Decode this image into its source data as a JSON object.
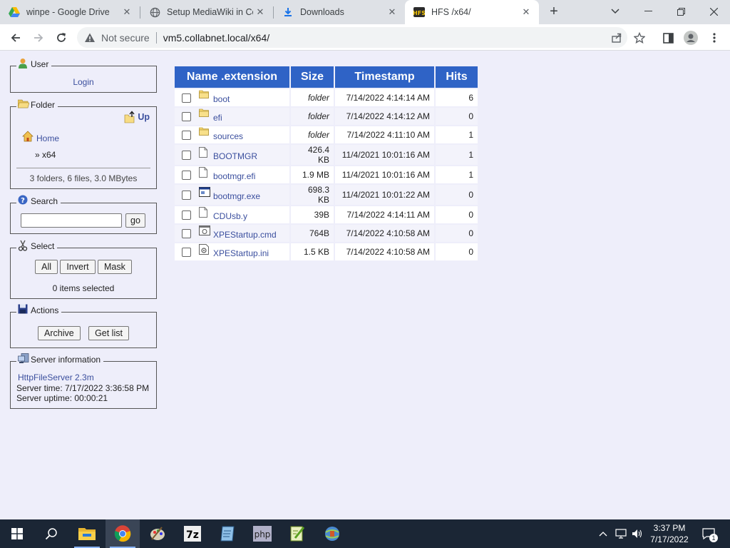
{
  "browser": {
    "tabs": [
      {
        "title": "winpe - Google Drive",
        "icon": "google-drive-icon"
      },
      {
        "title": "Setup MediaWiki in Co",
        "icon": "globe-icon"
      },
      {
        "title": "Downloads",
        "icon": "download-icon"
      },
      {
        "title": "HFS /x64/",
        "icon": "hfs-icon",
        "active": true
      }
    ],
    "security_label": "Not secure",
    "url": "vm5.collabnet.local/x64/"
  },
  "sidebar": {
    "user": {
      "legend": "User",
      "login": "Login"
    },
    "folder": {
      "legend": "Folder",
      "up": "Up",
      "home": "Home",
      "current": "» x64",
      "summary": "3 folders, 6 files, 3.0 MBytes"
    },
    "search": {
      "legend": "Search",
      "value": "",
      "go": "go"
    },
    "select": {
      "legend": "Select",
      "all": "All",
      "invert": "Invert",
      "mask": "Mask",
      "status": "0 items selected"
    },
    "actions": {
      "legend": "Actions",
      "archive": "Archive",
      "get_list": "Get list"
    },
    "server": {
      "legend": "Server information",
      "link": "HttpFileServer 2.3m",
      "time": "Server time: 7/17/2022 3:36:58 PM",
      "uptime": "Server uptime: 00:00:21"
    }
  },
  "table": {
    "headers": {
      "name": "Name .extension",
      "size": "Size",
      "timestamp": "Timestamp",
      "hits": "Hits"
    },
    "rows": [
      {
        "name": "boot",
        "type": "folder",
        "size": "folder",
        "timestamp": "7/14/2022 4:14:14 AM",
        "hits": "6"
      },
      {
        "name": "efi",
        "type": "folder",
        "size": "folder",
        "timestamp": "7/14/2022 4:14:12 AM",
        "hits": "0"
      },
      {
        "name": "sources",
        "type": "folder",
        "size": "folder",
        "timestamp": "7/14/2022 4:11:10 AM",
        "hits": "1"
      },
      {
        "name": "BOOTMGR",
        "type": "file",
        "size": "426.4 KB",
        "timestamp": "11/4/2021 10:01:16 AM",
        "hits": "1"
      },
      {
        "name": "bootmgr.efi",
        "type": "file",
        "size": "1.9 MB",
        "timestamp": "11/4/2021 10:01:16 AM",
        "hits": "1"
      },
      {
        "name": "bootmgr.exe",
        "type": "exe",
        "size": "698.3 KB",
        "timestamp": "11/4/2021 10:01:22 AM",
        "hits": "0"
      },
      {
        "name": "CDUsb.y",
        "type": "file",
        "size": "39B",
        "timestamp": "7/14/2022 4:14:11 AM",
        "hits": "0"
      },
      {
        "name": "XPEStartup.cmd",
        "type": "cmd",
        "size": "764B",
        "timestamp": "7/14/2022 4:10:58 AM",
        "hits": "0"
      },
      {
        "name": "XPEStartup.ini",
        "type": "ini",
        "size": "1.5 KB",
        "timestamp": "7/14/2022 4:10:58 AM",
        "hits": "0"
      }
    ]
  },
  "taskbar": {
    "apps": [
      "windows-start",
      "search-icon",
      "file-explorer-icon",
      "chrome-icon",
      "paint-icon",
      "7zip-icon",
      "notepad-icon",
      "php-icon",
      "notepadpp-icon",
      "hfs-app-icon"
    ],
    "time": "3:37 PM",
    "date": "7/17/2022",
    "notifications": "1"
  },
  "colors": {
    "header_blue": "#2f63c6",
    "page_bg": "#eeeefa",
    "link": "#3b4f9e",
    "taskbar": "#1b2635"
  }
}
